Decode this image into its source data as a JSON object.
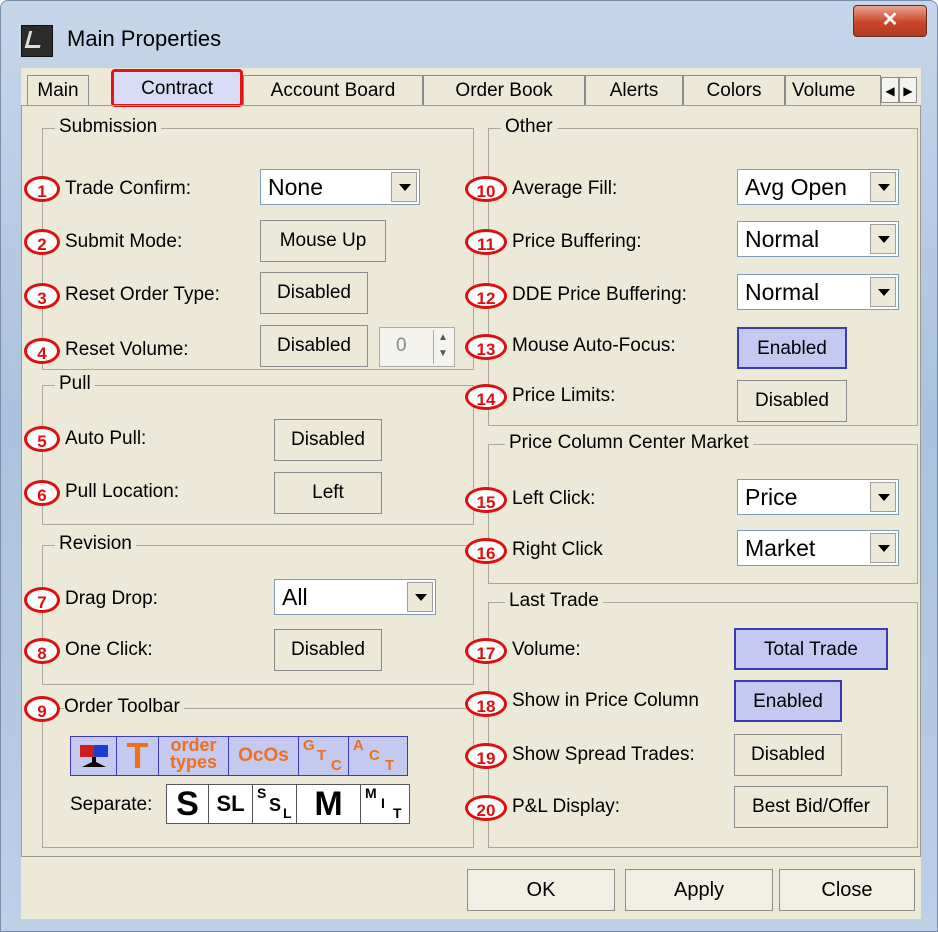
{
  "window": {
    "title": "Main Properties",
    "close_glyph": "✕"
  },
  "tabs": [
    "Main",
    "Contract",
    "Account Board",
    "Order Book",
    "Alerts",
    "Colors",
    "Volume"
  ],
  "selected_tab": "Contract",
  "submission": {
    "legend": "Submission",
    "trade_confirm": {
      "badge": "1",
      "label": "Trade Confirm:",
      "value": "None"
    },
    "submit_mode": {
      "badge": "2",
      "label": "Submit Mode:",
      "value": "Mouse Up"
    },
    "reset_order_type": {
      "badge": "3",
      "label": "Reset Order Type:",
      "value": "Disabled"
    },
    "reset_volume": {
      "badge": "4",
      "label": "Reset Volume:",
      "value": "Disabled",
      "spin_value": "0"
    }
  },
  "pull": {
    "legend": "Pull",
    "auto_pull": {
      "badge": "5",
      "label": "Auto Pull:",
      "value": "Disabled"
    },
    "pull_location": {
      "badge": "6",
      "label": "Pull Location:",
      "value": "Left"
    }
  },
  "revision": {
    "legend": "Revision",
    "drag_drop": {
      "badge": "7",
      "label": "Drag Drop:",
      "value": "All"
    },
    "one_click": {
      "badge": "8",
      "label": "One Click:",
      "value": "Disabled"
    }
  },
  "order_toolbar": {
    "badge": "9",
    "legend": "Order Toolbar",
    "row1": {
      "t": "T",
      "order": "order",
      "types": "types",
      "ocos": "OcOs",
      "gtc": [
        "G",
        "T",
        "C"
      ],
      "act": [
        "A",
        "C",
        "T"
      ]
    },
    "separate_label": "Separate:",
    "row2": {
      "s": "S",
      "sl": "SL",
      "ssl": [
        "S",
        "S",
        "L"
      ],
      "m": "M",
      "mit": [
        "M",
        "I",
        "T"
      ]
    }
  },
  "other": {
    "legend": "Other",
    "average_fill": {
      "badge": "10",
      "label": "Average Fill:",
      "value": "Avg Open"
    },
    "price_buffering": {
      "badge": "11",
      "label": "Price Buffering:",
      "value": "Normal"
    },
    "dde_price_buffering": {
      "badge": "12",
      "label": "DDE Price Buffering:",
      "value": "Normal"
    },
    "mouse_auto_focus": {
      "badge": "13",
      "label": "Mouse Auto-Focus:",
      "value": "Enabled"
    },
    "price_limits": {
      "badge": "14",
      "label": "Price Limits:",
      "value": "Disabled"
    }
  },
  "price_column_center_market": {
    "legend": "Price Column Center Market",
    "left_click": {
      "badge": "15",
      "label": "Left Click:",
      "value": "Price"
    },
    "right_click": {
      "badge": "16",
      "label": "Right Click",
      "value": "Market"
    }
  },
  "last_trade": {
    "legend": "Last Trade",
    "volume": {
      "badge": "17",
      "label": "Volume:",
      "value": "Total Trade"
    },
    "show_in_price_column": {
      "badge": "18",
      "label": "Show in Price Column",
      "value": "Enabled"
    },
    "show_spread_trades": {
      "badge": "19",
      "label": "Show Spread Trades:",
      "value": "Disabled"
    },
    "pl_display": {
      "badge": "20",
      "label": "P&L Display:",
      "value": "Best Bid/Offer"
    }
  },
  "buttons": {
    "ok": "OK",
    "apply": "Apply",
    "close": "Close"
  },
  "colors": {
    "badge_red": "#dd1010",
    "highlight_blue": "#c5c9ef",
    "toolbar_orange": "#ee6f1c"
  }
}
